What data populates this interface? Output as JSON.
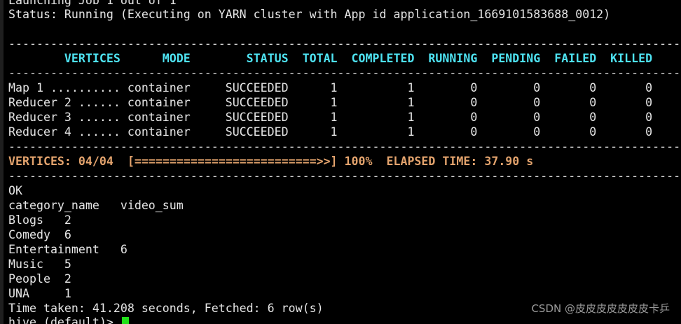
{
  "terminal": {
    "launch_line": "Launching Job 1 out of 1",
    "status_line": "Status: Running (Executing on YARN cluster with App id application_1669101583688_0012)",
    "separator": "------------------------------------------------------------------------------------------------",
    "header_line": "        VERTICES      MODE        STATUS  TOTAL  COMPLETED  RUNNING  PENDING  FAILED  KILLED",
    "rows": [
      "Map 1 .......... container     SUCCEEDED      1          1        0        0       0       0",
      "Reducer 2 ...... container     SUCCEEDED      1          1        0        0       0       0",
      "Reducer 3 ...... container     SUCCEEDED      1          1        0        0       0       0",
      "Reducer 4 ...... container     SUCCEEDED      1          1        0        0       0       0"
    ],
    "progress_line": "VERTICES: 04/04  [==========================>>] 100%  ELAPSED TIME: 37.90 s",
    "ok": "OK",
    "result_header": "category_name   video_sum",
    "results": [
      "Blogs   2",
      "Comedy  6",
      "Entertainment   6",
      "Music   5",
      "People  2",
      "UNA     1"
    ],
    "time_taken": "Time taken: 41.208 seconds, Fetched: 6 row(s)",
    "prompt": "hive (default)> "
  },
  "watermark": "CSDN @皮皮皮皮皮皮皮卡乒",
  "colors": {
    "background": "#000000",
    "header_cyan": "#4ee3f2",
    "progress_orange": "#e3a36d",
    "cursor_green": "#22e01a"
  }
}
